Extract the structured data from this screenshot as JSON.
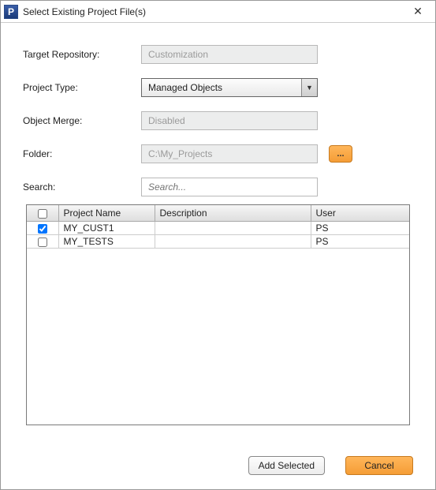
{
  "window": {
    "title": "Select Existing Project File(s)",
    "icon_letter": "P",
    "close_glyph": "✕"
  },
  "form": {
    "target_repository_label": "Target Repository:",
    "target_repository_value": "Customization",
    "project_type_label": "Project Type:",
    "project_type_value": "Managed Objects",
    "object_merge_label": "Object Merge:",
    "object_merge_value": "Disabled",
    "folder_label": "Folder:",
    "folder_value": "C:\\My_Projects",
    "browse_label": "...",
    "search_label": "Search:",
    "search_placeholder": "Search..."
  },
  "table": {
    "headers": {
      "checkbox": "",
      "project_name": "Project Name",
      "description": "Description",
      "user": "User"
    },
    "rows": [
      {
        "checked": true,
        "project_name": "MY_CUST1",
        "description": "",
        "user": "PS"
      },
      {
        "checked": false,
        "project_name": "MY_TESTS",
        "description": "",
        "user": "PS"
      }
    ]
  },
  "buttons": {
    "add_selected": "Add Selected",
    "cancel": "Cancel"
  }
}
